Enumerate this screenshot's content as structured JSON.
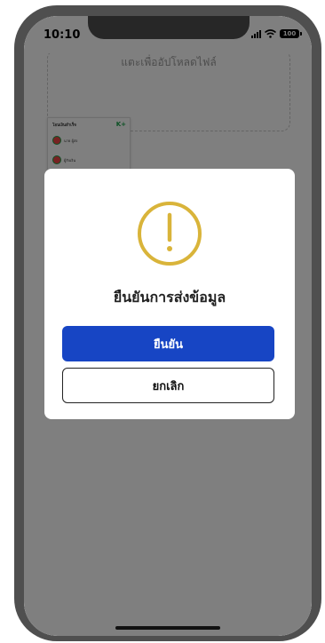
{
  "status_bar": {
    "time": "10:10",
    "battery": "100"
  },
  "background": {
    "upload_hint": "แตะเพื่ออัปโหลดไฟล์",
    "doc_thumb": {
      "title": "โอนเงินสำเร็จ",
      "brand": "K+",
      "row1": "นาย ผู้ส่ง",
      "row2": "ผู้รับเงิน"
    }
  },
  "dialog": {
    "icon": "warning-circle-icon",
    "title": "ยืนยันการส่งข้อมูล",
    "confirm_label": "ยืนยัน",
    "cancel_label": "ยกเลิก"
  },
  "colors": {
    "accent": "#1745c4",
    "warning": "#d9b43a",
    "overlay": "rgba(0,0,0,0.5)"
  }
}
